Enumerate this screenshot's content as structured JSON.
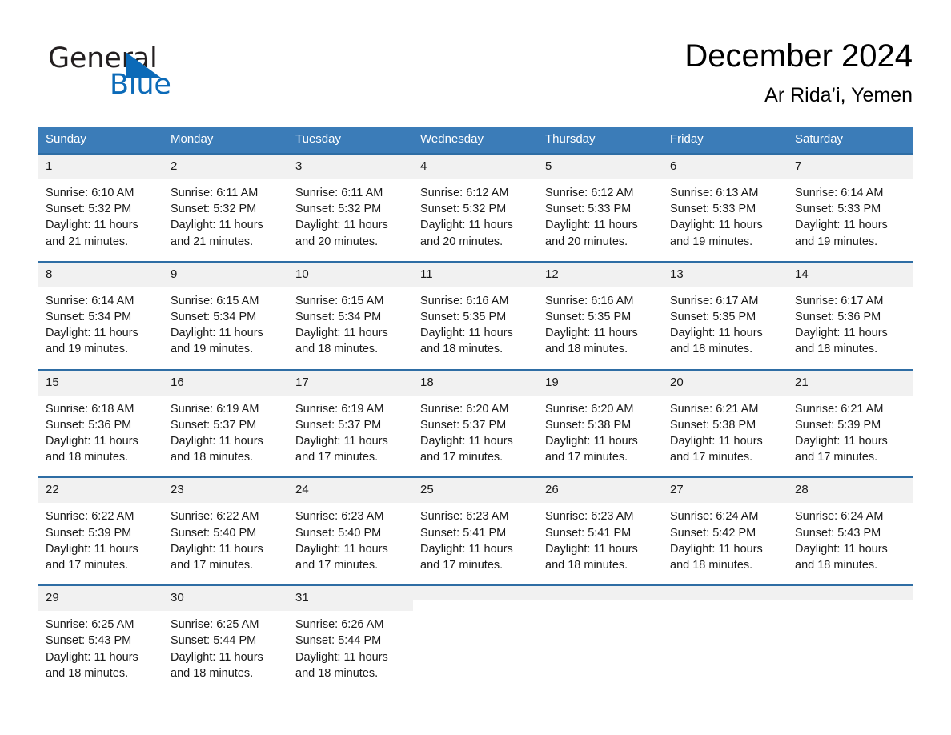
{
  "brand": {
    "name_part1": "General",
    "name_part2": "Blue",
    "logo_color": "#0b6ab8"
  },
  "header": {
    "title": "December 2024",
    "subtitle": "Ar Rida’i, Yemen"
  },
  "theme": {
    "header_row_bg": "#3b7cb8",
    "row_divider": "#2e6da4",
    "daynum_bg": "#f1f1f1",
    "text": "#1a1a1a"
  },
  "weekdays": [
    "Sunday",
    "Monday",
    "Tuesday",
    "Wednesday",
    "Thursday",
    "Friday",
    "Saturday"
  ],
  "labels": {
    "sunrise_prefix": "Sunrise:",
    "sunset_prefix": "Sunset:",
    "daylight_prefix": "Daylight:"
  },
  "weeks": [
    [
      {
        "day": "1",
        "sunrise": "Sunrise: 6:10 AM",
        "sunset": "Sunset: 5:32 PM",
        "daylight": "Daylight: 11 hours and 21 minutes."
      },
      {
        "day": "2",
        "sunrise": "Sunrise: 6:11 AM",
        "sunset": "Sunset: 5:32 PM",
        "daylight": "Daylight: 11 hours and 21 minutes."
      },
      {
        "day": "3",
        "sunrise": "Sunrise: 6:11 AM",
        "sunset": "Sunset: 5:32 PM",
        "daylight": "Daylight: 11 hours and 20 minutes."
      },
      {
        "day": "4",
        "sunrise": "Sunrise: 6:12 AM",
        "sunset": "Sunset: 5:32 PM",
        "daylight": "Daylight: 11 hours and 20 minutes."
      },
      {
        "day": "5",
        "sunrise": "Sunrise: 6:12 AM",
        "sunset": "Sunset: 5:33 PM",
        "daylight": "Daylight: 11 hours and 20 minutes."
      },
      {
        "day": "6",
        "sunrise": "Sunrise: 6:13 AM",
        "sunset": "Sunset: 5:33 PM",
        "daylight": "Daylight: 11 hours and 19 minutes."
      },
      {
        "day": "7",
        "sunrise": "Sunrise: 6:14 AM",
        "sunset": "Sunset: 5:33 PM",
        "daylight": "Daylight: 11 hours and 19 minutes."
      }
    ],
    [
      {
        "day": "8",
        "sunrise": "Sunrise: 6:14 AM",
        "sunset": "Sunset: 5:34 PM",
        "daylight": "Daylight: 11 hours and 19 minutes."
      },
      {
        "day": "9",
        "sunrise": "Sunrise: 6:15 AM",
        "sunset": "Sunset: 5:34 PM",
        "daylight": "Daylight: 11 hours and 19 minutes."
      },
      {
        "day": "10",
        "sunrise": "Sunrise: 6:15 AM",
        "sunset": "Sunset: 5:34 PM",
        "daylight": "Daylight: 11 hours and 18 minutes."
      },
      {
        "day": "11",
        "sunrise": "Sunrise: 6:16 AM",
        "sunset": "Sunset: 5:35 PM",
        "daylight": "Daylight: 11 hours and 18 minutes."
      },
      {
        "day": "12",
        "sunrise": "Sunrise: 6:16 AM",
        "sunset": "Sunset: 5:35 PM",
        "daylight": "Daylight: 11 hours and 18 minutes."
      },
      {
        "day": "13",
        "sunrise": "Sunrise: 6:17 AM",
        "sunset": "Sunset: 5:35 PM",
        "daylight": "Daylight: 11 hours and 18 minutes."
      },
      {
        "day": "14",
        "sunrise": "Sunrise: 6:17 AM",
        "sunset": "Sunset: 5:36 PM",
        "daylight": "Daylight: 11 hours and 18 minutes."
      }
    ],
    [
      {
        "day": "15",
        "sunrise": "Sunrise: 6:18 AM",
        "sunset": "Sunset: 5:36 PM",
        "daylight": "Daylight: 11 hours and 18 minutes."
      },
      {
        "day": "16",
        "sunrise": "Sunrise: 6:19 AM",
        "sunset": "Sunset: 5:37 PM",
        "daylight": "Daylight: 11 hours and 18 minutes."
      },
      {
        "day": "17",
        "sunrise": "Sunrise: 6:19 AM",
        "sunset": "Sunset: 5:37 PM",
        "daylight": "Daylight: 11 hours and 17 minutes."
      },
      {
        "day": "18",
        "sunrise": "Sunrise: 6:20 AM",
        "sunset": "Sunset: 5:37 PM",
        "daylight": "Daylight: 11 hours and 17 minutes."
      },
      {
        "day": "19",
        "sunrise": "Sunrise: 6:20 AM",
        "sunset": "Sunset: 5:38 PM",
        "daylight": "Daylight: 11 hours and 17 minutes."
      },
      {
        "day": "20",
        "sunrise": "Sunrise: 6:21 AM",
        "sunset": "Sunset: 5:38 PM",
        "daylight": "Daylight: 11 hours and 17 minutes."
      },
      {
        "day": "21",
        "sunrise": "Sunrise: 6:21 AM",
        "sunset": "Sunset: 5:39 PM",
        "daylight": "Daylight: 11 hours and 17 minutes."
      }
    ],
    [
      {
        "day": "22",
        "sunrise": "Sunrise: 6:22 AM",
        "sunset": "Sunset: 5:39 PM",
        "daylight": "Daylight: 11 hours and 17 minutes."
      },
      {
        "day": "23",
        "sunrise": "Sunrise: 6:22 AM",
        "sunset": "Sunset: 5:40 PM",
        "daylight": "Daylight: 11 hours and 17 minutes."
      },
      {
        "day": "24",
        "sunrise": "Sunrise: 6:23 AM",
        "sunset": "Sunset: 5:40 PM",
        "daylight": "Daylight: 11 hours and 17 minutes."
      },
      {
        "day": "25",
        "sunrise": "Sunrise: 6:23 AM",
        "sunset": "Sunset: 5:41 PM",
        "daylight": "Daylight: 11 hours and 17 minutes."
      },
      {
        "day": "26",
        "sunrise": "Sunrise: 6:23 AM",
        "sunset": "Sunset: 5:41 PM",
        "daylight": "Daylight: 11 hours and 18 minutes."
      },
      {
        "day": "27",
        "sunrise": "Sunrise: 6:24 AM",
        "sunset": "Sunset: 5:42 PM",
        "daylight": "Daylight: 11 hours and 18 minutes."
      },
      {
        "day": "28",
        "sunrise": "Sunrise: 6:24 AM",
        "sunset": "Sunset: 5:43 PM",
        "daylight": "Daylight: 11 hours and 18 minutes."
      }
    ],
    [
      {
        "day": "29",
        "sunrise": "Sunrise: 6:25 AM",
        "sunset": "Sunset: 5:43 PM",
        "daylight": "Daylight: 11 hours and 18 minutes."
      },
      {
        "day": "30",
        "sunrise": "Sunrise: 6:25 AM",
        "sunset": "Sunset: 5:44 PM",
        "daylight": "Daylight: 11 hours and 18 minutes."
      },
      {
        "day": "31",
        "sunrise": "Sunrise: 6:26 AM",
        "sunset": "Sunset: 5:44 PM",
        "daylight": "Daylight: 11 hours and 18 minutes."
      },
      {
        "day": "",
        "sunrise": "",
        "sunset": "",
        "daylight": ""
      },
      {
        "day": "",
        "sunrise": "",
        "sunset": "",
        "daylight": ""
      },
      {
        "day": "",
        "sunrise": "",
        "sunset": "",
        "daylight": ""
      },
      {
        "day": "",
        "sunrise": "",
        "sunset": "",
        "daylight": ""
      }
    ]
  ]
}
